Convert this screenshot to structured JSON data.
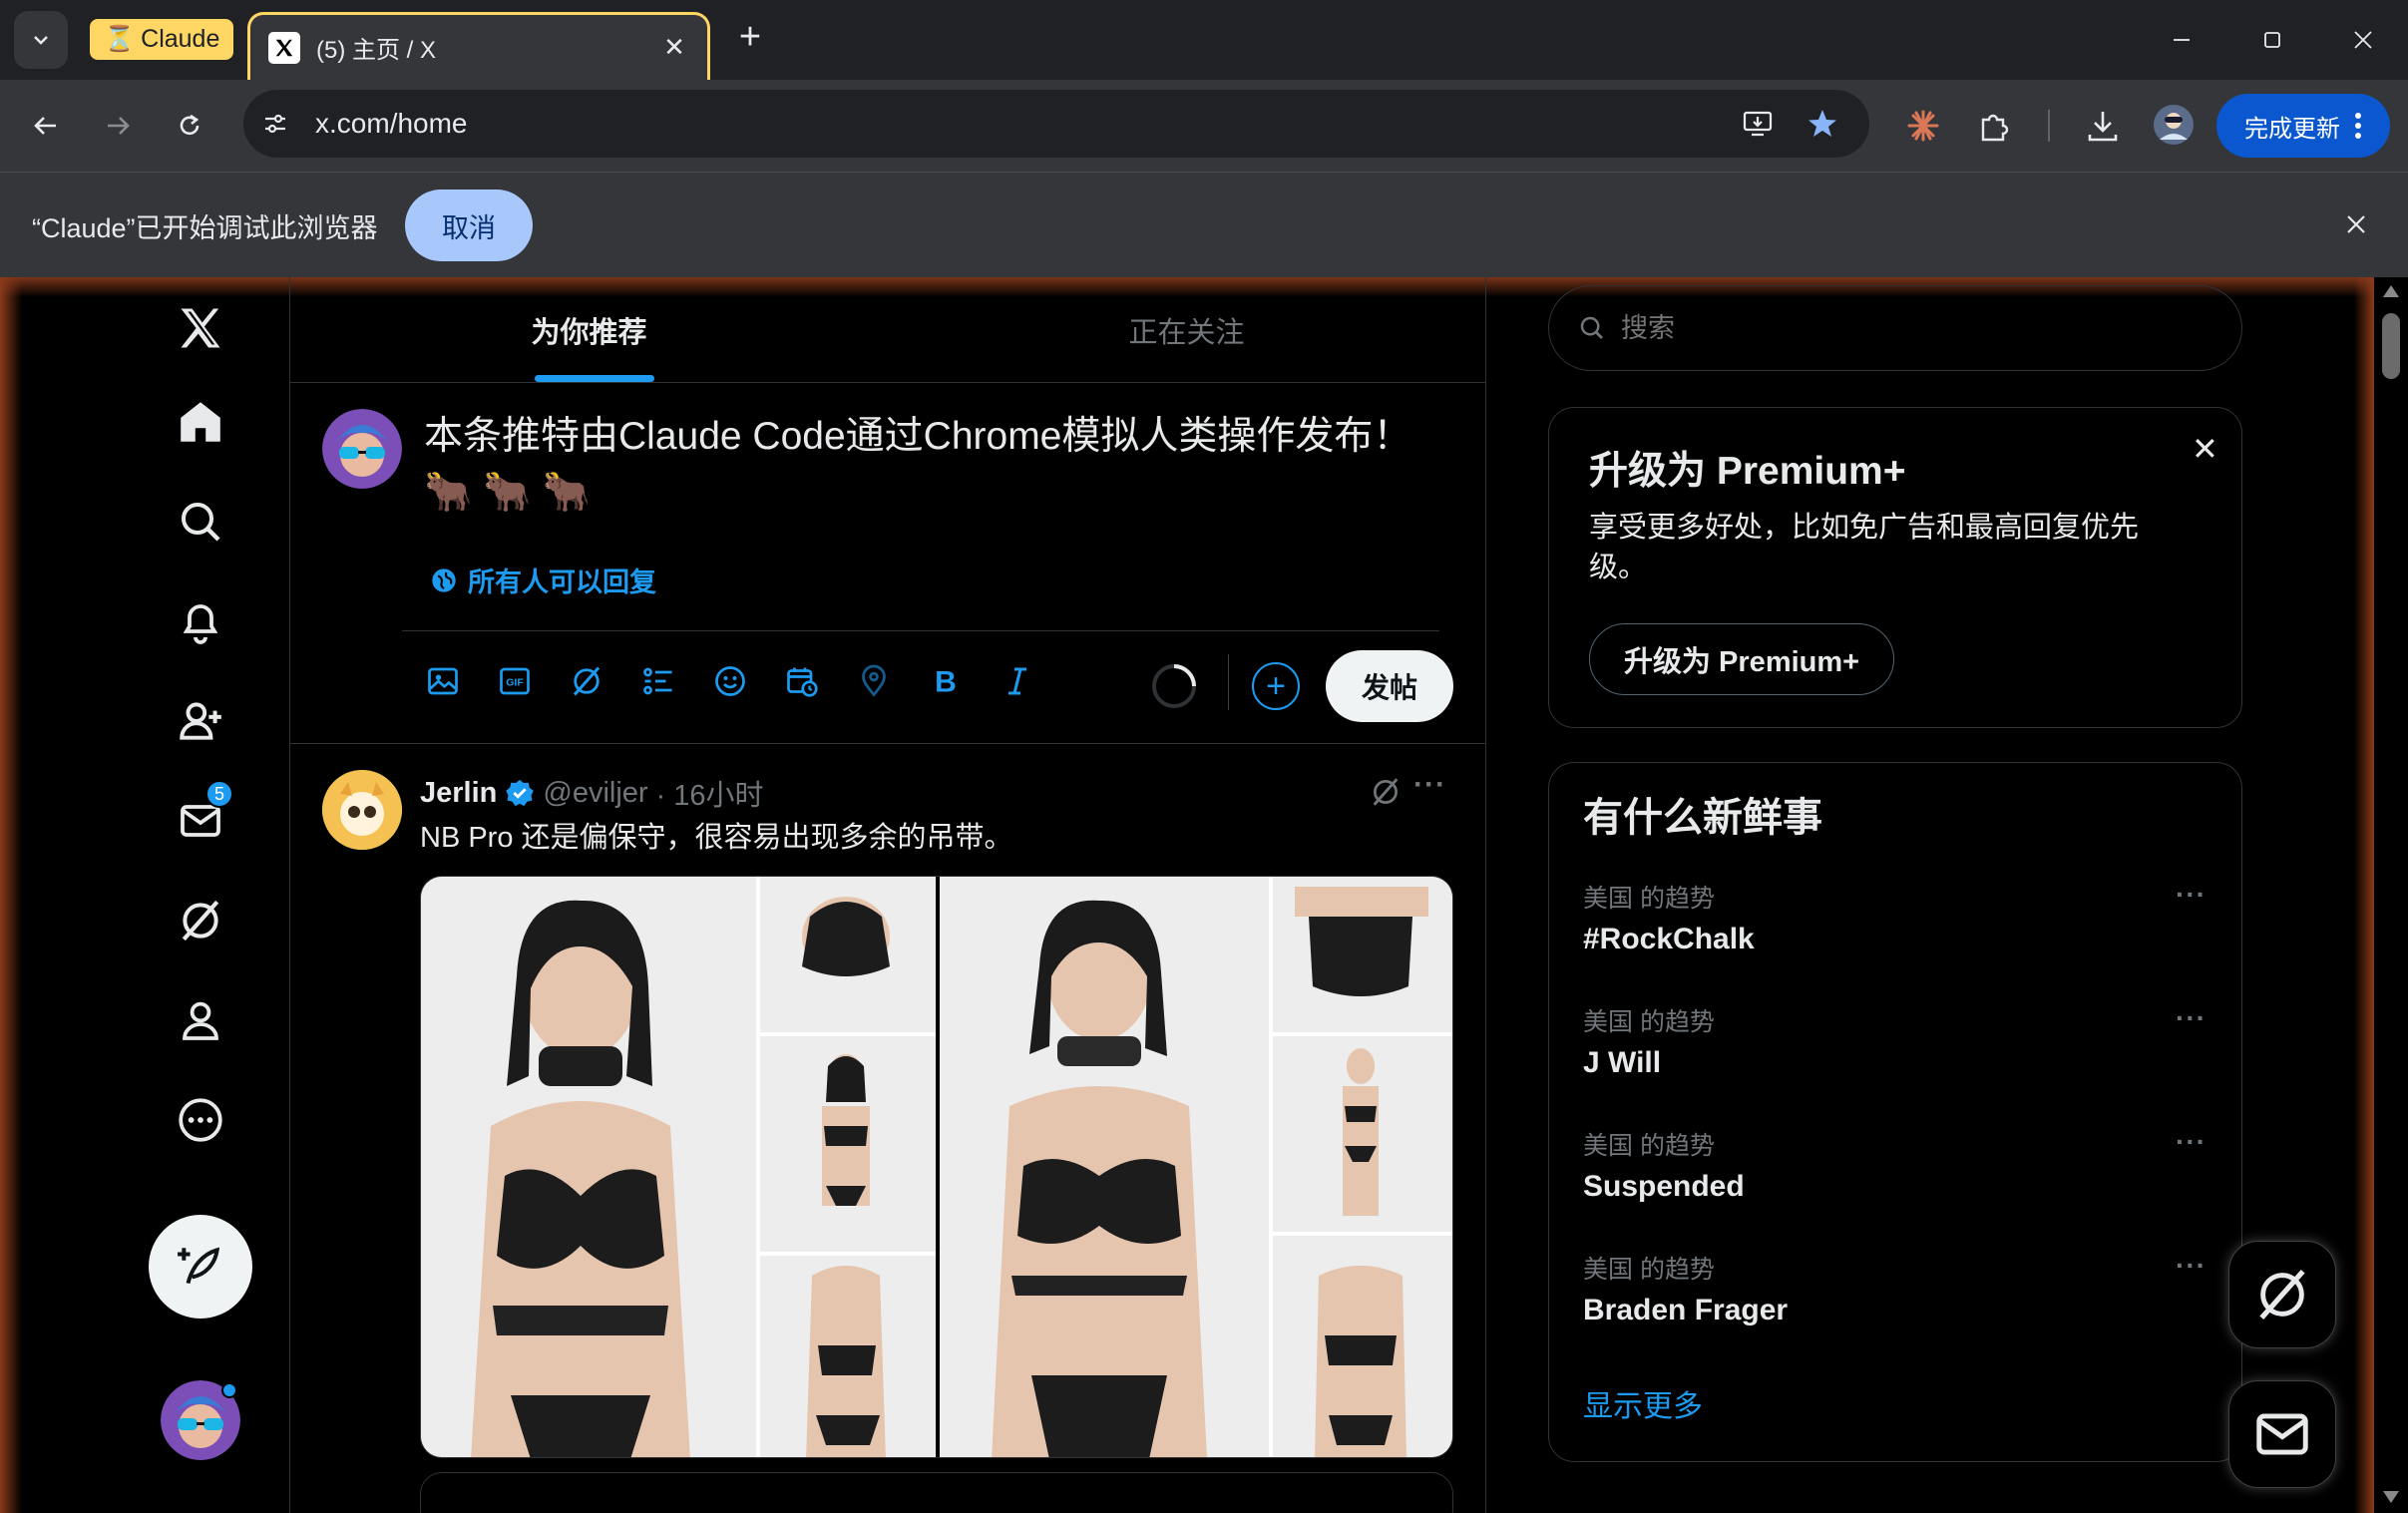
{
  "browser": {
    "group_label": "Claude",
    "tab_title": "(5) 主页 / X",
    "url": "x.com/home",
    "update_label": "完成更新",
    "infobar_text": "“Claude”已开始调试此浏览器",
    "infobar_cancel": "取消"
  },
  "sidebar": {
    "messages_badge": "5"
  },
  "feed": {
    "tabs": [
      "为你推荐",
      "正在关注"
    ],
    "active_tab": 0
  },
  "composer": {
    "text": "本条推特由Claude Code通过Chrome模拟人类操作发布！",
    "emoji": "🐂 🐂 🐂",
    "reply_setting": "所有人可以回复",
    "post_label": "发帖"
  },
  "tweet": {
    "name": "Jerlin",
    "handle": "@eviljer",
    "time": "· 16小时",
    "text": "NB Pro 还是偏保守，很容易出现多余的吊带。"
  },
  "right": {
    "search_placeholder": "搜索",
    "premium": {
      "title": "升级为 Premium+",
      "desc": "享受更多好处，比如免广告和最高回复优先级。",
      "button": "升级为 Premium+"
    },
    "trends": {
      "title": "有什么新鲜事",
      "items": [
        {
          "context": "美国 的趋势",
          "name": "#RockChalk"
        },
        {
          "context": "美国 的趋势",
          "name": "J Will"
        },
        {
          "context": "美国 的趋势",
          "name": "Suspended"
        },
        {
          "context": "美国 的趋势",
          "name": "Braden Frager"
        }
      ],
      "show_more": "显示更多"
    }
  },
  "colors": {
    "accent": "#1d9bf0",
    "background": "#000000",
    "border": "#2f3336",
    "group_tag": "#fdd663"
  }
}
